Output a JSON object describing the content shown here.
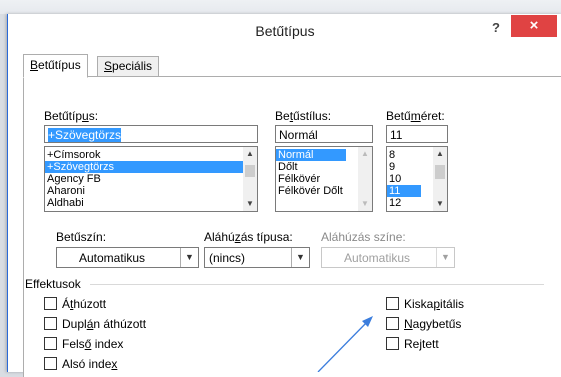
{
  "dialog": {
    "title": "Betűtípus",
    "help": "?",
    "close": "×"
  },
  "tabs": [
    {
      "pre": "",
      "acc": "B",
      "post": "etűtípus"
    },
    {
      "pre": "",
      "acc": "S",
      "post": "peciális"
    }
  ],
  "font": {
    "label_pre": "Betűtíp",
    "label_acc": "u",
    "label_post": "s:",
    "value": "+Szövegtörzs",
    "items": [
      "+Címsorok",
      "+Szövegtörzs",
      "Agency FB",
      "Aharoni",
      "Aldhabi"
    ],
    "selected": "+Szövegtörzs"
  },
  "style": {
    "label_pre": "Be",
    "label_acc": "t",
    "label_post": "űstílus:",
    "value": "Normál",
    "items": [
      "Normál",
      "Dőlt",
      "Félkövér",
      "Félkövér Dőlt"
    ],
    "selected": "Normál"
  },
  "size": {
    "label_pre": "Betű",
    "label_acc": "m",
    "label_post": "éret:",
    "value": "11",
    "items": [
      "8",
      "9",
      "10",
      "11",
      "12"
    ],
    "selected": "11"
  },
  "fontcolor": {
    "label": "Betűszín:",
    "value": "Automatikus"
  },
  "underline": {
    "label_pre": "Aláhú",
    "label_acc": "z",
    "label_post": "ás típusa:",
    "value": "(nincs)"
  },
  "underline_color": {
    "label": "Aláhúzás színe:",
    "value": "Automatikus"
  },
  "effects": {
    "title": "Effektusok",
    "left": [
      {
        "pre": "Á",
        "acc": "t",
        "post": "húzott"
      },
      {
        "pre": "Dupl",
        "acc": "á",
        "post": "n áthúzott"
      },
      {
        "pre": "Fels",
        "acc": "ő",
        "post": " index"
      },
      {
        "pre": "Alsó inde",
        "acc": "x",
        "post": ""
      }
    ],
    "right": [
      {
        "pre": "Kiska",
        "acc": "p",
        "post": "itális"
      },
      {
        "pre": "",
        "acc": "N",
        "post": "agybetűs"
      },
      {
        "pre": "Re",
        "acc": "j",
        "post": "tett"
      }
    ]
  },
  "colors": {
    "accent": "#3399ff",
    "close": "#e04343",
    "arrow": "#3b7ddd"
  }
}
